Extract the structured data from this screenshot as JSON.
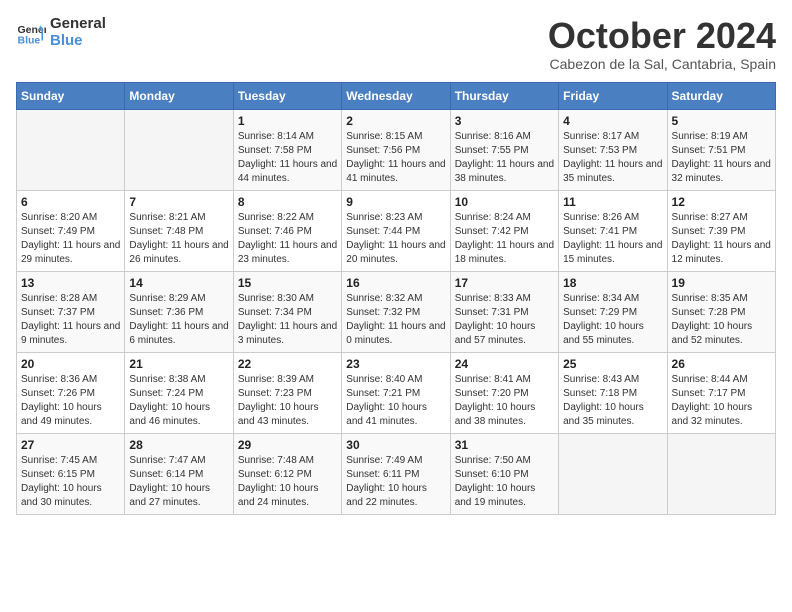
{
  "header": {
    "logo_line1": "General",
    "logo_line2": "Blue",
    "month": "October 2024",
    "location": "Cabezon de la Sal, Cantabria, Spain"
  },
  "days_of_week": [
    "Sunday",
    "Monday",
    "Tuesday",
    "Wednesday",
    "Thursday",
    "Friday",
    "Saturday"
  ],
  "weeks": [
    [
      {
        "day": "",
        "info": ""
      },
      {
        "day": "",
        "info": ""
      },
      {
        "day": "1",
        "sunrise": "8:14 AM",
        "sunset": "7:58 PM",
        "daylight": "11 hours and 44 minutes."
      },
      {
        "day": "2",
        "sunrise": "8:15 AM",
        "sunset": "7:56 PM",
        "daylight": "11 hours and 41 minutes."
      },
      {
        "day": "3",
        "sunrise": "8:16 AM",
        "sunset": "7:55 PM",
        "daylight": "11 hours and 38 minutes."
      },
      {
        "day": "4",
        "sunrise": "8:17 AM",
        "sunset": "7:53 PM",
        "daylight": "11 hours and 35 minutes."
      },
      {
        "day": "5",
        "sunrise": "8:19 AM",
        "sunset": "7:51 PM",
        "daylight": "11 hours and 32 minutes."
      }
    ],
    [
      {
        "day": "6",
        "sunrise": "8:20 AM",
        "sunset": "7:49 PM",
        "daylight": "11 hours and 29 minutes."
      },
      {
        "day": "7",
        "sunrise": "8:21 AM",
        "sunset": "7:48 PM",
        "daylight": "11 hours and 26 minutes."
      },
      {
        "day": "8",
        "sunrise": "8:22 AM",
        "sunset": "7:46 PM",
        "daylight": "11 hours and 23 minutes."
      },
      {
        "day": "9",
        "sunrise": "8:23 AM",
        "sunset": "7:44 PM",
        "daylight": "11 hours and 20 minutes."
      },
      {
        "day": "10",
        "sunrise": "8:24 AM",
        "sunset": "7:42 PM",
        "daylight": "11 hours and 18 minutes."
      },
      {
        "day": "11",
        "sunrise": "8:26 AM",
        "sunset": "7:41 PM",
        "daylight": "11 hours and 15 minutes."
      },
      {
        "day": "12",
        "sunrise": "8:27 AM",
        "sunset": "7:39 PM",
        "daylight": "11 hours and 12 minutes."
      }
    ],
    [
      {
        "day": "13",
        "sunrise": "8:28 AM",
        "sunset": "7:37 PM",
        "daylight": "11 hours and 9 minutes."
      },
      {
        "day": "14",
        "sunrise": "8:29 AM",
        "sunset": "7:36 PM",
        "daylight": "11 hours and 6 minutes."
      },
      {
        "day": "15",
        "sunrise": "8:30 AM",
        "sunset": "7:34 PM",
        "daylight": "11 hours and 3 minutes."
      },
      {
        "day": "16",
        "sunrise": "8:32 AM",
        "sunset": "7:32 PM",
        "daylight": "11 hours and 0 minutes."
      },
      {
        "day": "17",
        "sunrise": "8:33 AM",
        "sunset": "7:31 PM",
        "daylight": "10 hours and 57 minutes."
      },
      {
        "day": "18",
        "sunrise": "8:34 AM",
        "sunset": "7:29 PM",
        "daylight": "10 hours and 55 minutes."
      },
      {
        "day": "19",
        "sunrise": "8:35 AM",
        "sunset": "7:28 PM",
        "daylight": "10 hours and 52 minutes."
      }
    ],
    [
      {
        "day": "20",
        "sunrise": "8:36 AM",
        "sunset": "7:26 PM",
        "daylight": "10 hours and 49 minutes."
      },
      {
        "day": "21",
        "sunrise": "8:38 AM",
        "sunset": "7:24 PM",
        "daylight": "10 hours and 46 minutes."
      },
      {
        "day": "22",
        "sunrise": "8:39 AM",
        "sunset": "7:23 PM",
        "daylight": "10 hours and 43 minutes."
      },
      {
        "day": "23",
        "sunrise": "8:40 AM",
        "sunset": "7:21 PM",
        "daylight": "10 hours and 41 minutes."
      },
      {
        "day": "24",
        "sunrise": "8:41 AM",
        "sunset": "7:20 PM",
        "daylight": "10 hours and 38 minutes."
      },
      {
        "day": "25",
        "sunrise": "8:43 AM",
        "sunset": "7:18 PM",
        "daylight": "10 hours and 35 minutes."
      },
      {
        "day": "26",
        "sunrise": "8:44 AM",
        "sunset": "7:17 PM",
        "daylight": "10 hours and 32 minutes."
      }
    ],
    [
      {
        "day": "27",
        "sunrise": "7:45 AM",
        "sunset": "6:15 PM",
        "daylight": "10 hours and 30 minutes."
      },
      {
        "day": "28",
        "sunrise": "7:47 AM",
        "sunset": "6:14 PM",
        "daylight": "10 hours and 27 minutes."
      },
      {
        "day": "29",
        "sunrise": "7:48 AM",
        "sunset": "6:12 PM",
        "daylight": "10 hours and 24 minutes."
      },
      {
        "day": "30",
        "sunrise": "7:49 AM",
        "sunset": "6:11 PM",
        "daylight": "10 hours and 22 minutes."
      },
      {
        "day": "31",
        "sunrise": "7:50 AM",
        "sunset": "6:10 PM",
        "daylight": "10 hours and 19 minutes."
      },
      {
        "day": "",
        "info": ""
      },
      {
        "day": "",
        "info": ""
      }
    ]
  ]
}
